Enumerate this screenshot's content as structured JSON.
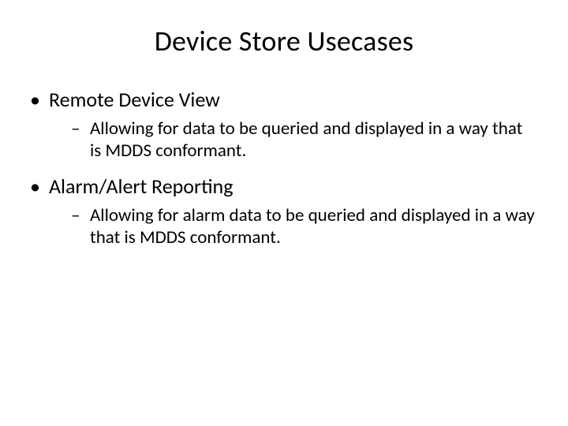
{
  "title": "Device Store Usecases",
  "bullets": [
    {
      "label": "Remote Device View",
      "sub": "Allowing for data to be queried and displayed in a way that is MDDS conformant."
    },
    {
      "label": "Alarm/Alert Reporting",
      "sub": "Allowing for alarm data to be queried and displayed in a way that is MDDS conformant."
    }
  ]
}
